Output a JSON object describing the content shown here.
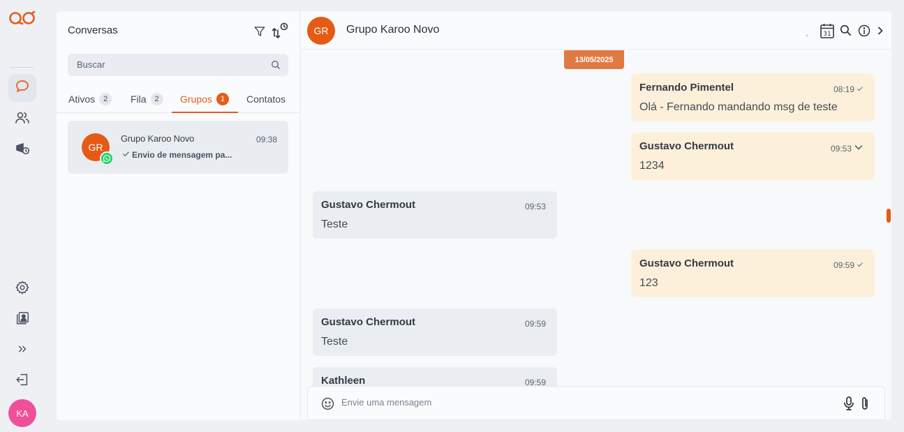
{
  "app": {
    "brand": "QO"
  },
  "rail": {
    "items": [
      "chat-icon",
      "contacts-icon",
      "campaign-icon",
      "settings-icon",
      "address-book-icon",
      "expand-icon",
      "logout-icon"
    ],
    "user_initials": "KA",
    "accent": "#e35d1f"
  },
  "list": {
    "title": "Conversas",
    "search_placeholder": "Buscar",
    "tabs": [
      {
        "label": "Ativos",
        "count": "2"
      },
      {
        "label": "Fila",
        "count": "2"
      },
      {
        "label": "Grupos",
        "count": "1"
      },
      {
        "label": "Contatos",
        "count": ""
      }
    ],
    "active_tab": "Grupos",
    "conversations": [
      {
        "initials": "GR",
        "name": "Grupo Karoo Novo",
        "time": "09:38",
        "preview": "Envio de mensagem pa..."
      }
    ]
  },
  "chat": {
    "initials": "GR",
    "title": "Grupo Karoo Novo",
    "calendar_day": "31",
    "date_chip": "13/05/2025",
    "messages": [
      {
        "direction": "out",
        "sender": "Fernando Pimentel",
        "text": "Olá - Fernando mandando msg de teste",
        "time": "08:19"
      },
      {
        "direction": "out",
        "sender": "Gustavo Chermout",
        "text": "1234",
        "time": "09:53"
      },
      {
        "direction": "in",
        "sender": "Gustavo Chermout",
        "text": "Teste",
        "time": "09:53"
      },
      {
        "direction": "out",
        "sender": "Gustavo Chermout",
        "text": "123",
        "time": "09:59"
      },
      {
        "direction": "in",
        "sender": "Gustavo Chermout",
        "text": "Teste",
        "time": "09:59"
      },
      {
        "direction": "in",
        "sender": "Kathleen",
        "text": "",
        "time": "09:59"
      }
    ],
    "composer_placeholder": "Envie uma mensagem"
  }
}
